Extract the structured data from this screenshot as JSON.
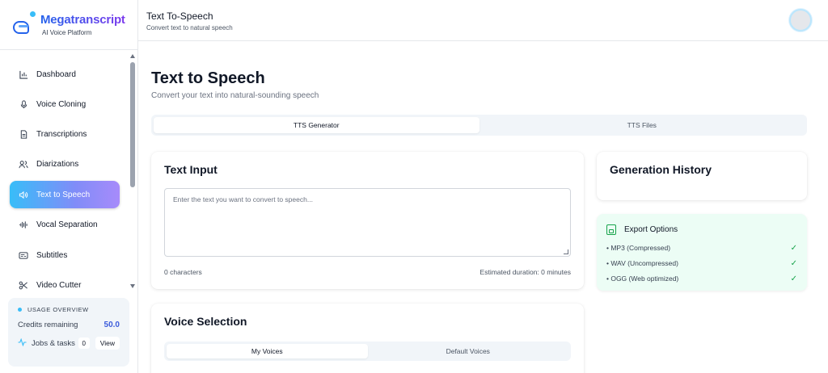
{
  "brand": {
    "name": "Megatranscript",
    "tagline": "AI Voice Platform"
  },
  "sidebar": {
    "items": [
      {
        "label": "Dashboard",
        "icon": "bar-chart-icon",
        "active": false
      },
      {
        "label": "Voice Cloning",
        "icon": "microphone-icon",
        "active": false
      },
      {
        "label": "Transcriptions",
        "icon": "document-icon",
        "active": false
      },
      {
        "label": "Diarizations",
        "icon": "users-icon",
        "active": false
      },
      {
        "label": "Text to Speech",
        "icon": "speaker-icon",
        "active": true
      },
      {
        "label": "Vocal Separation",
        "icon": "waveform-icon",
        "active": false
      },
      {
        "label": "Subtitles",
        "icon": "subtitles-icon",
        "active": false
      },
      {
        "label": "Video Cutter",
        "icon": "scissors-icon",
        "active": false
      }
    ]
  },
  "usage": {
    "title": "USAGE OVERVIEW",
    "credits_label": "Credits remaining",
    "credits_value": "50.0",
    "jobs_label": "Jobs & tasks",
    "jobs_count": "0",
    "view_label": "View"
  },
  "header": {
    "title": "Text To-Speech",
    "subtitle": "Convert text to natural speech"
  },
  "main": {
    "title": "Text to Speech",
    "subtitle": "Convert your text into natural-sounding speech",
    "tabs": [
      {
        "label": "TTS Generator",
        "active": true
      },
      {
        "label": "TTS Files",
        "active": false
      }
    ]
  },
  "text_input": {
    "title": "Text Input",
    "placeholder": "Enter the text you want to convert to speech...",
    "char_count": "0 characters",
    "duration": "Estimated duration: 0 minutes"
  },
  "history": {
    "title": "Generation History"
  },
  "export": {
    "title": "Export Options",
    "items": [
      {
        "label": "• MP3 (Compressed)",
        "check": "✓"
      },
      {
        "label": "• WAV (Uncompressed)",
        "check": "✓"
      },
      {
        "label": "• OGG (Web optimized)",
        "check": "✓"
      }
    ]
  },
  "voice": {
    "title": "Voice Selection",
    "tabs": [
      {
        "label": "My Voices",
        "active": true
      },
      {
        "label": "Default Voices",
        "active": false
      }
    ]
  },
  "colors": {
    "accent": "#3b5bdb",
    "active_gradient_start": "#38bdf8",
    "active_gradient_end": "#a78bfa",
    "success": "#16a34a",
    "export_bg": "#ecfdf5"
  }
}
